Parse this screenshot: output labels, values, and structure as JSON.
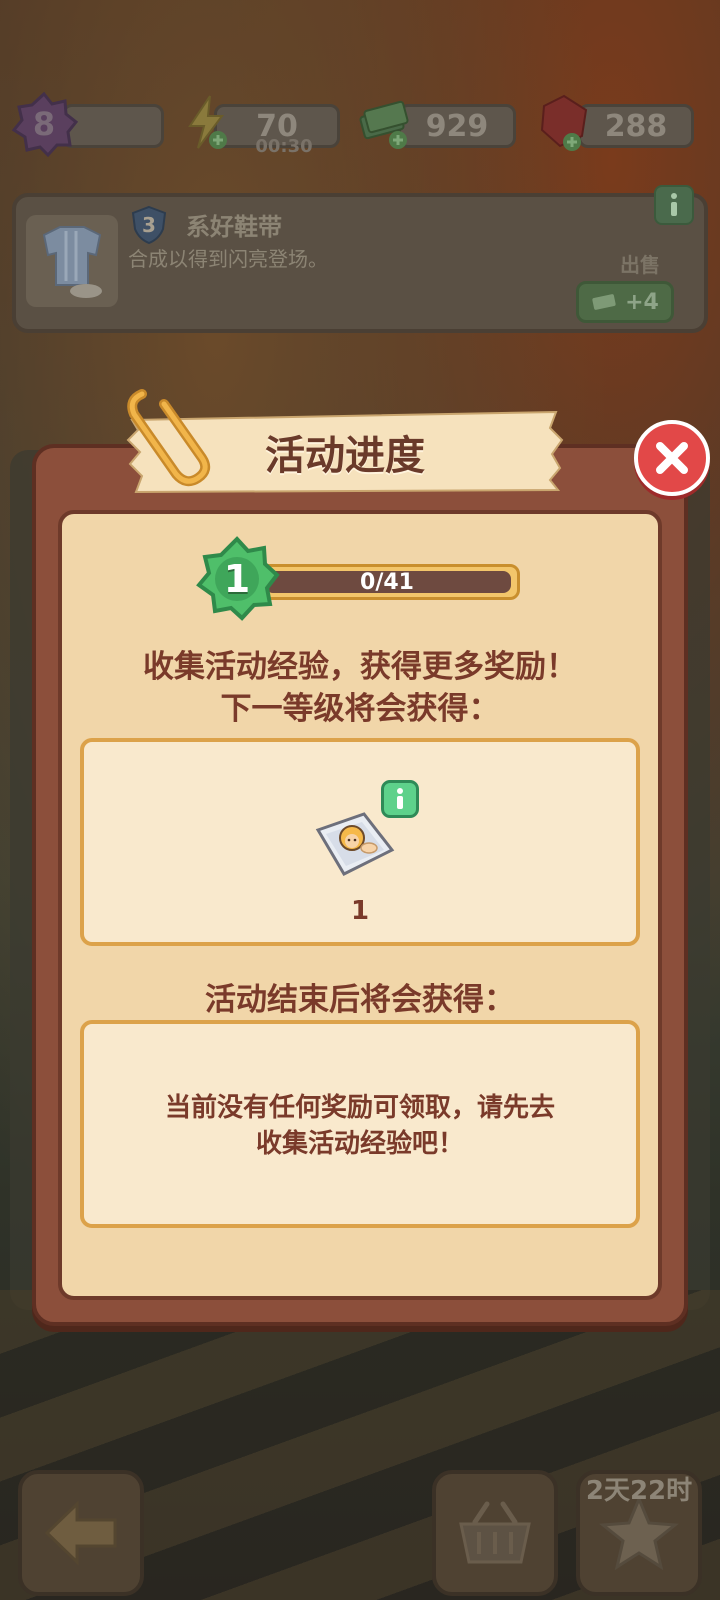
{
  "top_bar": {
    "player_level": "8",
    "energy": {
      "value": "70",
      "timer": "00:30"
    },
    "cash": {
      "value": "929"
    },
    "gems": {
      "value": "288"
    }
  },
  "quest": {
    "step": "3",
    "title": "系好鞋带",
    "description": "合成以得到闪亮登场。",
    "sell_label": "出售",
    "sell_reward": "+4"
  },
  "modal": {
    "title": "活动进度",
    "event_level": "1",
    "progress_text": "0/41",
    "progress_fraction": 0,
    "headline_line1": "收集活动经验，获得更多奖励！",
    "headline_line2": "下一等级将会获得：",
    "next_reward_count": "1",
    "end_heading": "活动结束后将会获得：",
    "end_message_line1": "当前没有任何奖励可领取，请先去",
    "end_message_line2": "收集活动经验吧！"
  },
  "bottom_bar": {
    "event_timer": "2天22时"
  },
  "colors": {
    "modal_frame": "#8c4f3b",
    "panel": "#f1d6a9",
    "text_brown": "#7a3a2a",
    "close_red": "#e24848",
    "xp_green": "#4fbf6a",
    "box_border": "#dca24a"
  },
  "icons": [
    "level-flower-icon",
    "energy-bolt-icon",
    "cash-stack-icon",
    "gem-icon",
    "shield-icon",
    "info-icon",
    "close-icon",
    "paperclip-icon",
    "blanket-baby-icon",
    "back-arrow-icon",
    "basket-icon",
    "star-icon"
  ]
}
